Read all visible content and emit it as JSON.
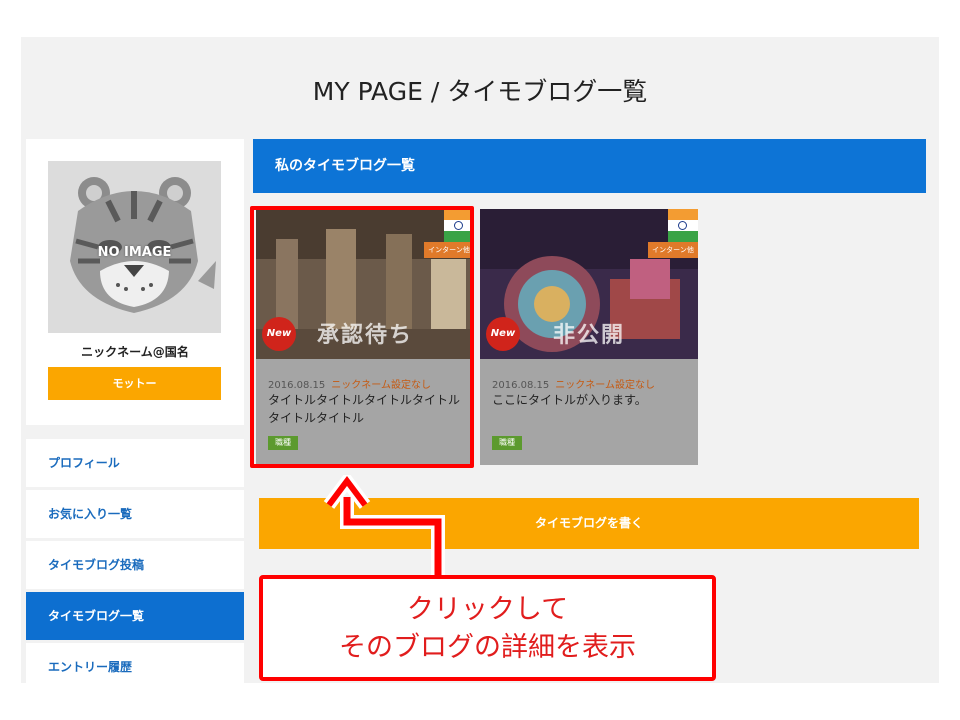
{
  "page": {
    "title": "MY PAGE / タイモブログ一覧"
  },
  "profile": {
    "avatar_text": "NO IMAGE",
    "nickname": "ニックネーム@国名",
    "motto_label": "モットー"
  },
  "menu": {
    "items": [
      {
        "label": "プロフィール"
      },
      {
        "label": "お気に入り一覧"
      },
      {
        "label": "タイモブログ投稿"
      },
      {
        "label": "タイモブログ一覧",
        "active": true
      },
      {
        "label": "エントリー履歴"
      }
    ]
  },
  "section": {
    "title": "私のタイモブログ一覧"
  },
  "cards": [
    {
      "status": "承認待ち",
      "new_label": "New",
      "badge": "インターン他",
      "date": "2016.08.15",
      "author": "ニックネーム設定なし",
      "title": "タイトルタイトルタイトルタイトルタイトルタイトル",
      "tag": "職種"
    },
    {
      "status": "非公開",
      "new_label": "New",
      "badge": "インターン他",
      "date": "2016.08.15",
      "author": "ニックネーム設定なし",
      "title": "ここにタイトルが入ります。",
      "tag": "職種"
    }
  ],
  "actions": {
    "write_label": "タイモブログを書く"
  },
  "annotation": {
    "line1": "クリックして",
    "line2": "そのブログの詳細を表示"
  },
  "colors": {
    "accent_blue": "#0d74d6",
    "accent_orange": "#fba600",
    "annotation_red": "#ff0000"
  }
}
